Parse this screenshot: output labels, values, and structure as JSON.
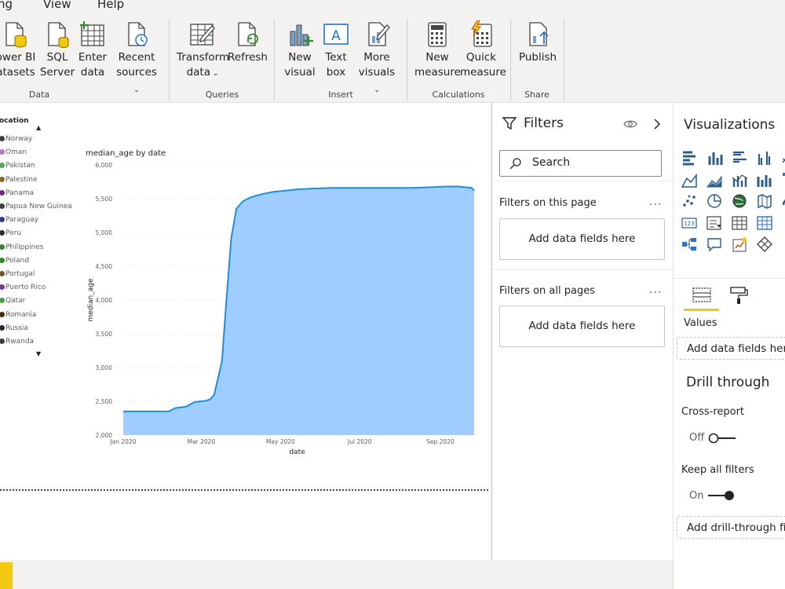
{
  "menu": {
    "item1": "ng",
    "item2": "View",
    "item3": "Help"
  },
  "ribbon": {
    "data_group": {
      "label": "Data",
      "power_bi_line1": "ower BI",
      "power_bi_line2": "atasets",
      "sql_line1": "SQL",
      "sql_line2": "Server",
      "enter_line1": "Enter",
      "enter_line2": "data",
      "recent_line1": "Recent",
      "recent_line2": "sources"
    },
    "queries_group": {
      "label": "Queries",
      "transform_line1": "Transform",
      "transform_line2": "data",
      "refresh_label": "Refresh"
    },
    "insert_group": {
      "label": "Insert",
      "newvisual_line1": "New",
      "newvisual_line2": "visual",
      "textbox_line1": "Text",
      "textbox_line2": "box",
      "more_line1": "More",
      "more_line2": "visuals"
    },
    "calc_group": {
      "label": "Calculations",
      "newmeasure_line1": "New",
      "newmeasure_line2": "measure",
      "quick_line1": "Quick",
      "quick_line2": "measure"
    },
    "share_group": {
      "label": "Share",
      "publish_label": "Publish"
    }
  },
  "legend": {
    "title": "ocation",
    "items": [
      {
        "label": "Norway",
        "color": "#3d3d3d"
      },
      {
        "label": "Oman",
        "color": "#b07cc6"
      },
      {
        "label": "Pakistan",
        "color": "#5aa05a"
      },
      {
        "label": "Palestine",
        "color": "#8a6a2c"
      },
      {
        "label": "Panama",
        "color": "#6d2c73"
      },
      {
        "label": "Papua New Guinea",
        "color": "#3d3d3d"
      },
      {
        "label": "Paraguay",
        "color": "#2f3c78"
      },
      {
        "label": "Peru",
        "color": "#2b2b2b"
      },
      {
        "label": "Philippines",
        "color": "#3a7d3a"
      },
      {
        "label": "Poland",
        "color": "#2d8a2d"
      },
      {
        "label": "Portugal",
        "color": "#6b5a2a"
      },
      {
        "label": "Puerto Rico",
        "color": "#7a3a8a"
      },
      {
        "label": "Qatar",
        "color": "#4a9a4a"
      },
      {
        "label": "Romania",
        "color": "#4a2a1a"
      },
      {
        "label": "Russia",
        "color": "#2a2a3a"
      },
      {
        "label": "Rwanda",
        "color": "#3d3d3d"
      }
    ]
  },
  "chart_data": {
    "type": "area",
    "title": "median_age by date",
    "xlabel": "date",
    "ylabel": "median_age",
    "ylim": [
      2000,
      6000
    ],
    "y_ticks": [
      "2,000",
      "2,500",
      "3,000",
      "3,500",
      "4,000",
      "4,500",
      "5,000",
      "5,500",
      "6,000"
    ],
    "x_ticks": [
      "Jan 2020",
      "Mar 2020",
      "May 2020",
      "Jul 2020",
      "Sep 2020"
    ],
    "grid": true,
    "color": "#9fcdff",
    "line_color": "#1f8ee0",
    "series": [
      {
        "x": [
          "2020-01-01",
          "2020-01-10",
          "2020-01-20",
          "2020-01-27",
          "2020-02-01",
          "2020-02-05",
          "2020-02-10",
          "2020-02-18",
          "2020-02-25",
          "2020-03-01",
          "2020-03-05",
          "2020-03-08",
          "2020-03-11",
          "2020-03-14",
          "2020-03-17",
          "2020-03-20",
          "2020-03-24",
          "2020-03-28",
          "2020-04-02",
          "2020-04-08",
          "2020-04-15",
          "2020-04-25",
          "2020-05-05",
          "2020-05-15",
          "2020-05-25",
          "2020-06-10",
          "2020-06-25",
          "2020-07-10",
          "2020-07-25",
          "2020-08-10",
          "2020-08-25",
          "2020-09-05",
          "2020-09-15",
          "2020-09-25",
          "2020-09-27"
        ],
        "y": [
          2350,
          2350,
          2350,
          2350,
          2350,
          2350,
          2400,
          2420,
          2490,
          2500,
          2510,
          2530,
          2600,
          2850,
          3100,
          3900,
          4900,
          5350,
          5460,
          5520,
          5560,
          5600,
          5620,
          5640,
          5650,
          5660,
          5660,
          5660,
          5660,
          5660,
          5670,
          5680,
          5680,
          5660,
          5620
        ]
      }
    ]
  },
  "filters": {
    "title": "Filters",
    "search_placeholder": "Search",
    "on_this_page": "Filters on this page",
    "on_this_page_drop": "Add data fields here",
    "on_all_pages": "Filters on all pages",
    "on_all_pages_drop": "Add data fields here",
    "more": "..."
  },
  "viz": {
    "title": "Visualizations",
    "values_label": "Values",
    "values_drop": "Add data fields here",
    "drill_title": "Drill through",
    "cross_report": "Cross-report",
    "cross_report_state": "Off",
    "keep_filters": "Keep all filters",
    "keep_filters_state": "On",
    "drill_drop": "Add drill-through fiel"
  },
  "icons": {
    "accent": "#f2c811",
    "grid_icons": [
      "stacked-bar-icon",
      "stacked-column-icon",
      "clustered-bar-icon",
      "clustered-column-icon",
      "line-chart-icon",
      "area-chart-icon",
      "stacked-area-icon",
      "line-column-icon",
      "ribbon-chart-icon",
      "funnel-icon",
      "scatter-icon",
      "pie-icon",
      "globe-map-icon",
      "filled-map-icon",
      "gauge-icon",
      "card-icon",
      "slicer-icon",
      "table-icon",
      "matrix-icon",
      "r-visual-icon",
      "decomposition-tree-icon",
      "qa-icon",
      "key-influencers-icon",
      "more-visuals-icon"
    ]
  }
}
